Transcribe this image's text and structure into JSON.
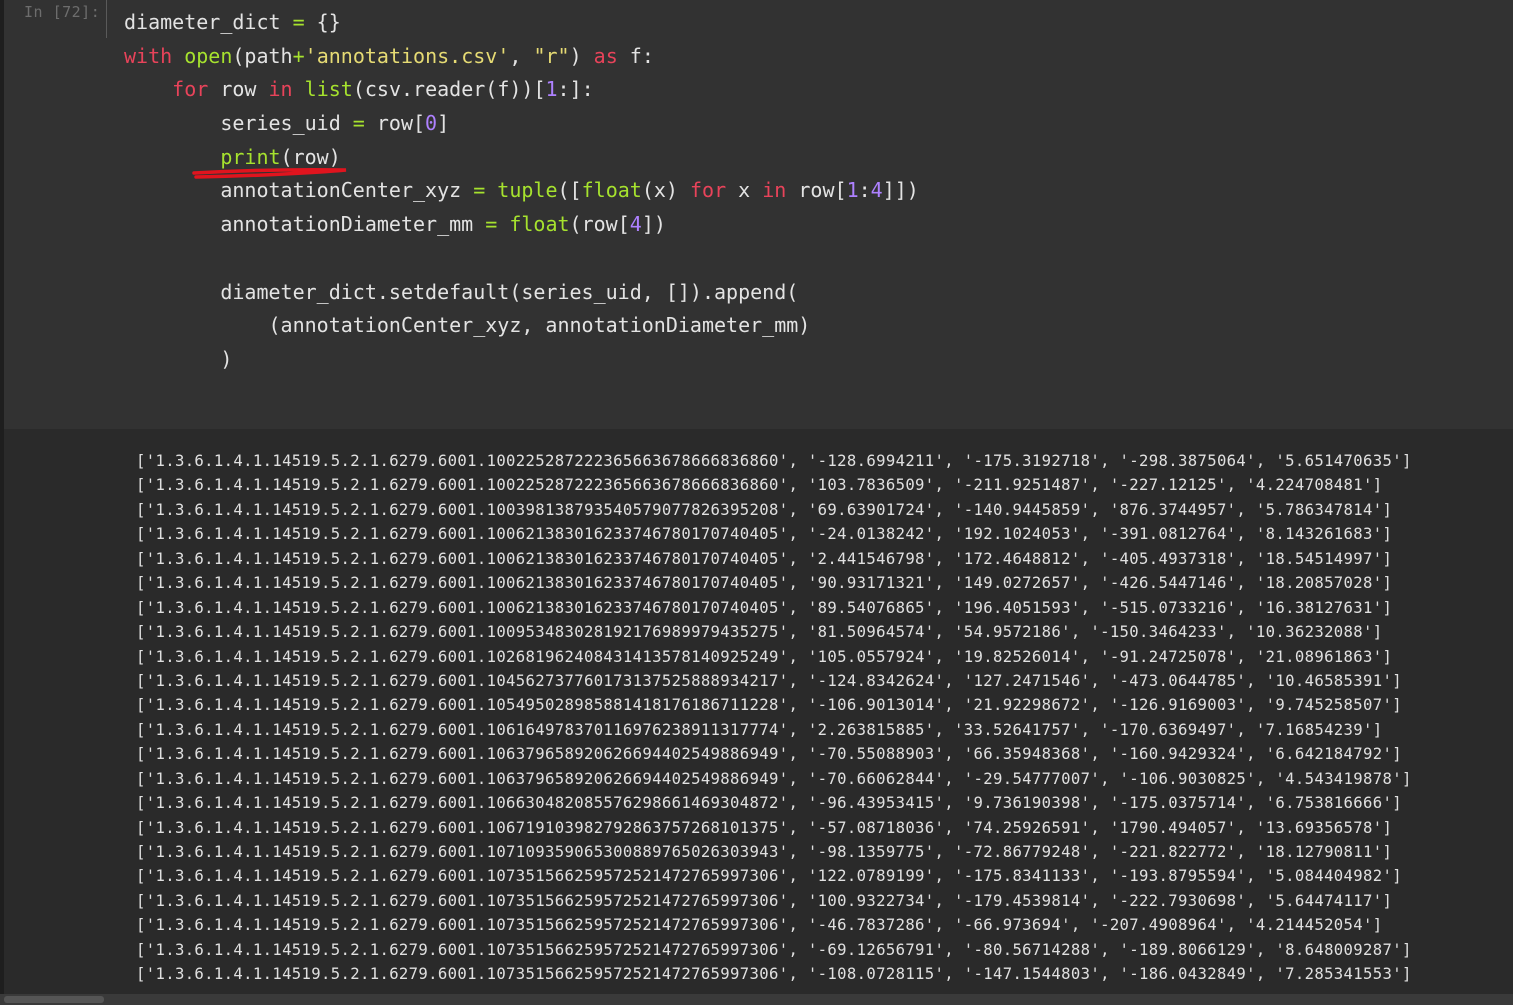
{
  "cell": {
    "prompt": "In [72]:",
    "code_lines": [
      "diameter_dict = {}",
      "with open(path+'annotations.csv', \"r\") as f:",
      "    for row in list(csv.reader(f))[1:]:",
      "        series_uid = row[0]",
      "        print(row)",
      "        annotationCenter_xyz = tuple([float(x) for x in row[1:4]])",
      "        annotationDiameter_mm = float(row[4])",
      "",
      "        diameter_dict.setdefault(series_uid, []).append(",
      "            (annotationCenter_xyz, annotationDiameter_mm)",
      "        )"
    ],
    "annotation_color": "#e0141e"
  },
  "output": {
    "rows": [
      "['1.3.6.1.4.1.14519.5.2.1.6279.6001.100225287222365663678666836860', '-128.6994211', '-175.3192718', '-298.3875064', '5.651470635']",
      "['1.3.6.1.4.1.14519.5.2.1.6279.6001.100225287222365663678666836860', '103.7836509', '-211.9251487', '-227.12125', '4.224708481']",
      "['1.3.6.1.4.1.14519.5.2.1.6279.6001.100398138793540579077826395208', '69.63901724', '-140.9445859', '876.3744957', '5.786347814']",
      "['1.3.6.1.4.1.14519.5.2.1.6279.6001.100621383016233746780170740405', '-24.0138242', '192.1024053', '-391.0812764', '8.143261683']",
      "['1.3.6.1.4.1.14519.5.2.1.6279.6001.100621383016233746780170740405', '2.441546798', '172.4648812', '-405.4937318', '18.54514997']",
      "['1.3.6.1.4.1.14519.5.2.1.6279.6001.100621383016233746780170740405', '90.93171321', '149.0272657', '-426.5447146', '18.20857028']",
      "['1.3.6.1.4.1.14519.5.2.1.6279.6001.100621383016233746780170740405', '89.54076865', '196.4051593', '-515.0733216', '16.38127631']",
      "['1.3.6.1.4.1.14519.5.2.1.6279.6001.100953483028192176989979435275', '81.50964574', '54.9572186', '-150.3464233', '10.36232088']",
      "['1.3.6.1.4.1.14519.5.2.1.6279.6001.102681962408431413578140925249', '105.0557924', '19.82526014', '-91.24725078', '21.08961863']",
      "['1.3.6.1.4.1.14519.5.2.1.6279.6001.104562737760173137525888934217', '-124.8342624', '127.2471546', '-473.0644785', '10.46585391']",
      "['1.3.6.1.4.1.14519.5.2.1.6279.6001.105495028985881418176186711228', '-106.9013014', '21.92298672', '-126.9169003', '9.745258507']",
      "['1.3.6.1.4.1.14519.5.2.1.6279.6001.106164978370116976238911317774', '2.263815885', '33.52641757', '-170.6369497', '7.16854239']",
      "['1.3.6.1.4.1.14519.5.2.1.6279.6001.106379658920626694402549886949', '-70.55088903', '66.35948368', '-160.9429324', '6.642184792']",
      "['1.3.6.1.4.1.14519.5.2.1.6279.6001.106379658920626694402549886949', '-70.66062844', '-29.54777007', '-106.9030825', '4.543419878']",
      "['1.3.6.1.4.1.14519.5.2.1.6279.6001.106630482085576298661469304872', '-96.43953415', '9.736190398', '-175.0375714', '6.753816666']",
      "['1.3.6.1.4.1.14519.5.2.1.6279.6001.106719103982792863757268101375', '-57.08718036', '74.25926591', '1790.494057', '13.69356578']",
      "['1.3.6.1.4.1.14519.5.2.1.6279.6001.107109359065300889765026303943', '-98.1359775', '-72.86779248', '-221.822772', '18.12790811']",
      "['1.3.6.1.4.1.14519.5.2.1.6279.6001.107351566259572521472765997306', '122.0789199', '-175.8341133', '-193.8795594', '5.084404982']",
      "['1.3.6.1.4.1.14519.5.2.1.6279.6001.107351566259572521472765997306', '100.9322734', '-179.4539814', '-222.7930698', '5.64474117']",
      "['1.3.6.1.4.1.14519.5.2.1.6279.6001.107351566259572521472765997306', '-46.7837286', '-66.973694', '-207.4908964', '4.214452054']",
      "['1.3.6.1.4.1.14519.5.2.1.6279.6001.107351566259572521472765997306', '-69.12656791', '-80.56714288', '-189.8066129', '8.648009287']",
      "['1.3.6.1.4.1.14519.5.2.1.6279.6001.107351566259572521472765997306', '-108.0728115', '-147.1544803', '-186.0432849', '7.285341553']"
    ]
  }
}
